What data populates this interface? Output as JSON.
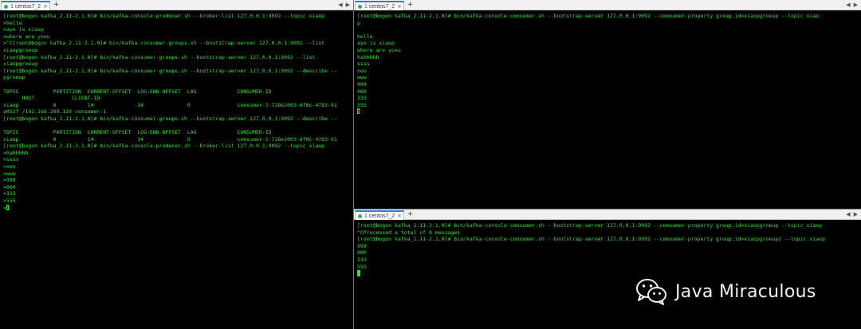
{
  "left_pane": {
    "tab_label": "1 centos7_2",
    "tab_close_icon": "close-icon",
    "add_tab_symbol": "+",
    "nav_left": "◀",
    "nav_right": "▶",
    "lines": [
      "[root@bogon kafka_2.11-2.1.0]# bin/kafka-console-producer.sh --broker-list 127.0.0.1:9092 --topic xiaop",
      ">hello",
      ">ayo is xiaop",
      ">where are yoeu",
      ">^C[root@bogon kafka_2.11-2.1.0]# bin/kafka-consumer-groups.sh --bootstrap-server 127.0.0.1:9092 --list",
      "xiaopgroeup",
      "[root@bogon kafka_2.11-2.1.0]# bin/kafka-consumer-groups.sh --bootstrap-server 127.0.0.1:9092 --list",
      "xiaopgroeup",
      "[root@bogon kafka_2.11-2.1.0]# bin/kafka-consumer-groups.sh --bootstrap-server 127.0.0.1:9092 --describe --",
      "pgroeup",
      "",
      "TOPIC           PARTITION  CURRENT-OFFSET  LOG-END-OFFSET  LAG             CONSUMER-ID",
      "      HOST            CLIENT-ID",
      "xiaop           0          14              14              0               consumer-1-728e2003-6f0c-4783-91",
      "a052f /192.168.209.129 consumer-1",
      "[root@bogon kafka_2.11-2.1.0]# bin/kafka-consumer-groups.sh --bootstrap-server 127.0.0.1:9092 --describe --",
      "",
      "TOPIC           PARTITION  CURRENT-OFFSET  LOG-END-OFFSET  LAG             CONSUMER-ID",
      "xiaop           0          14              14              0               consumer-1-728e2003-6f0c-4783-91",
      "[root@bogon kafka_2.11-2.1.0]# bin/kafka-console-producer.sh --broker-list 127.0.0.1:9092 --topic xiaop",
      ">hahhhhh",
      ">ssss",
      ">ooo",
      ">www",
      ">999",
      ">000",
      ">333",
      ">555",
      ">"
    ]
  },
  "top_right_pane": {
    "tab_label": "1 centos7_2",
    "tab_close_icon": "close-icon",
    "add_tab_symbol": "+",
    "nav_left": "◀",
    "nav_right": "▶",
    "lines": [
      "[root@bogon kafka_2.11-2.1.0]# bin/kafka-console-consumer.sh --bootstrap-server 127.0.0.1:9092 --consumer-property group.id=xiaopgroeup --topic xiao",
      "p",
      "",
      "hello",
      "ayo is xiaop",
      "where are yoeu",
      "hahhhhh",
      "ssss",
      "ooo",
      "www",
      "999",
      "000",
      "333",
      "555",
      ""
    ]
  },
  "bottom_right_pane": {
    "tab_label": "1 centos7_2",
    "tab_close_icon": "close-icon",
    "add_tab_symbol": "+",
    "nav_left": "◀",
    "nav_right": "▶",
    "lines": [
      "[root@bogon kafka_2.11-2.1.0]# bin/kafka-console-consumer.sh --bootstrap-server 127.0.0.1:9092 --consumer-property group.id=xiaopgroeup --topic xiaop",
      "^CProcessed a total of 0 messages",
      "[root@bogon kafka_2.11-2.1.0]# bin/kafka-console-consumer.sh --bootstrap-server 127.0.0.1:9092 --consumer-property group.id=xiaopgroeup2 --topic xiaop",
      "999",
      "000",
      "333",
      "555",
      ""
    ]
  },
  "watermark": {
    "icon": "wechat-icon",
    "text": "Java Miraculous"
  },
  "colors": {
    "terminal_background": "#000000",
    "terminal_text": "#35e035",
    "tab_active_accent": "#2f7bd6",
    "tab_status_dot": "#2bb34b",
    "tabbar_background": "#f0f0f0"
  }
}
